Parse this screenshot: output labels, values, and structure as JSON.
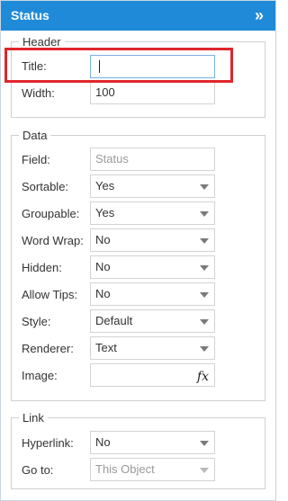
{
  "panel": {
    "title": "Status"
  },
  "header_group": {
    "legend": "Header",
    "title_label": "Title:",
    "title_value": "",
    "width_label": "Width:",
    "width_value": "100"
  },
  "data_group": {
    "legend": "Data",
    "field_label": "Field:",
    "field_value": "Status",
    "sortable_label": "Sortable:",
    "sortable_value": "Yes",
    "groupable_label": "Groupable:",
    "groupable_value": "Yes",
    "wordwrap_label": "Word Wrap:",
    "wordwrap_value": "No",
    "hidden_label": "Hidden:",
    "hidden_value": "No",
    "allowtips_label": "Allow Tips:",
    "allowtips_value": "No",
    "style_label": "Style:",
    "style_value": "Default",
    "renderer_label": "Renderer:",
    "renderer_value": "Text",
    "image_label": "Image:",
    "image_value": "",
    "fx_icon": "fx"
  },
  "link_group": {
    "legend": "Link",
    "hyperlink_label": "Hyperlink:",
    "hyperlink_value": "No",
    "goto_label": "Go to:",
    "goto_value": "This Object"
  },
  "colors": {
    "header_bg": "#1f8ad8",
    "highlight": "#e0262d"
  }
}
